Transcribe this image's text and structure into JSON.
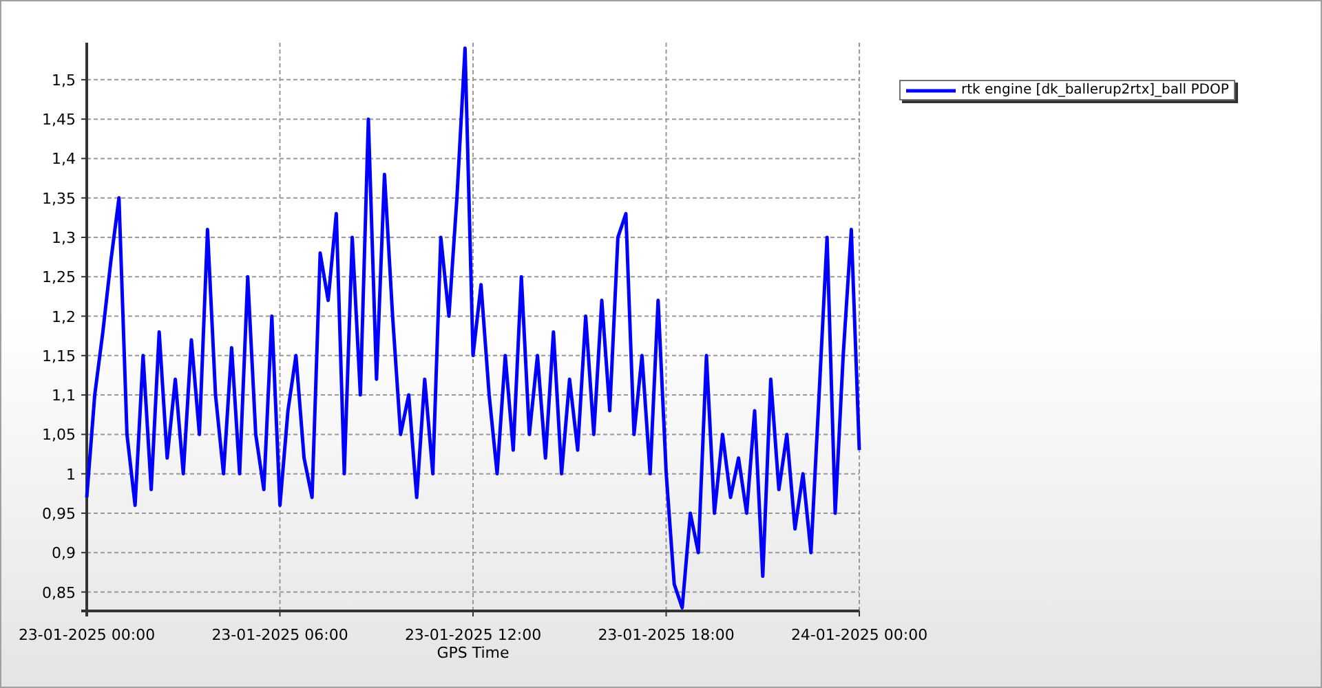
{
  "chart": {
    "chart_data": {
      "type": "line",
      "grid": true,
      "xlabel": "GPS Time",
      "ylim": [
        0.826,
        1.547
      ],
      "categories": [
        "23-01-2025 00:00",
        null,
        null,
        null,
        null,
        null,
        null,
        null,
        null,
        null,
        null,
        null,
        null,
        null,
        null,
        null,
        null,
        null,
        null,
        null,
        null,
        null,
        null,
        null,
        "23-01-2025 06:00",
        null,
        null,
        null,
        null,
        null,
        null,
        null,
        null,
        null,
        null,
        null,
        null,
        null,
        null,
        null,
        null,
        null,
        null,
        null,
        null,
        null,
        null,
        null,
        "23-01-2025 12:00",
        null,
        null,
        null,
        null,
        null,
        null,
        null,
        null,
        null,
        null,
        null,
        null,
        null,
        null,
        null,
        null,
        null,
        null,
        null,
        null,
        null,
        null,
        null,
        "23-01-2025 18:00",
        null,
        null,
        null,
        null,
        null,
        null,
        null,
        null,
        null,
        null,
        null,
        null,
        null,
        null,
        null,
        null,
        null,
        null,
        null,
        null,
        null,
        null,
        null,
        "24-01-2025 00:00"
      ],
      "yticks": [
        {
          "value": 0.85,
          "label": "0,85"
        },
        {
          "value": 0.9,
          "label": "0,9"
        },
        {
          "value": 0.95,
          "label": "0,95"
        },
        {
          "value": 1,
          "label": "1"
        },
        {
          "value": 1.05,
          "label": "1,05"
        },
        {
          "value": 1.1,
          "label": "1,1"
        },
        {
          "value": 1.15,
          "label": "1,15"
        },
        {
          "value": 1.2,
          "label": "1,2"
        },
        {
          "value": 1.25,
          "label": "1,25"
        },
        {
          "value": 1.3,
          "label": "1,3"
        },
        {
          "value": 1.35,
          "label": "1,35"
        },
        {
          "value": 1.4,
          "label": "1,4"
        },
        {
          "value": 1.45,
          "label": "1,45"
        },
        {
          "value": 1.5,
          "label": "1,5"
        }
      ],
      "series": [
        {
          "name": "rtk engine [dk_ballerup2rtx]_ball PDOP",
          "color": "#0000ff",
          "values": [
            0.97,
            1.1,
            1.18,
            1.27,
            1.35,
            1.05,
            0.96,
            1.15,
            0.98,
            1.18,
            1.02,
            1.12,
            1.0,
            1.17,
            1.05,
            1.31,
            1.1,
            1.0,
            1.16,
            1.0,
            1.25,
            1.05,
            0.98,
            1.2,
            0.96,
            1.08,
            1.15,
            1.02,
            0.97,
            1.28,
            1.22,
            1.33,
            1.0,
            1.3,
            1.1,
            1.45,
            1.12,
            1.38,
            1.2,
            1.05,
            1.1,
            0.97,
            1.12,
            1.0,
            1.3,
            1.2,
            1.35,
            1.54,
            1.15,
            1.24,
            1.1,
            1.0,
            1.15,
            1.03,
            1.25,
            1.05,
            1.15,
            1.02,
            1.18,
            1.0,
            1.12,
            1.03,
            1.2,
            1.05,
            1.22,
            1.08,
            1.3,
            1.33,
            1.05,
            1.15,
            1.0,
            1.22,
            1.0,
            0.86,
            0.83,
            0.95,
            0.9,
            1.15,
            0.95,
            1.05,
            0.97,
            1.02,
            0.95,
            1.08,
            0.87,
            1.12,
            0.98,
            1.05,
            0.93,
            1.0,
            0.9,
            1.1,
            1.3,
            0.95,
            1.15,
            1.31,
            1.03
          ]
        }
      ]
    }
  }
}
